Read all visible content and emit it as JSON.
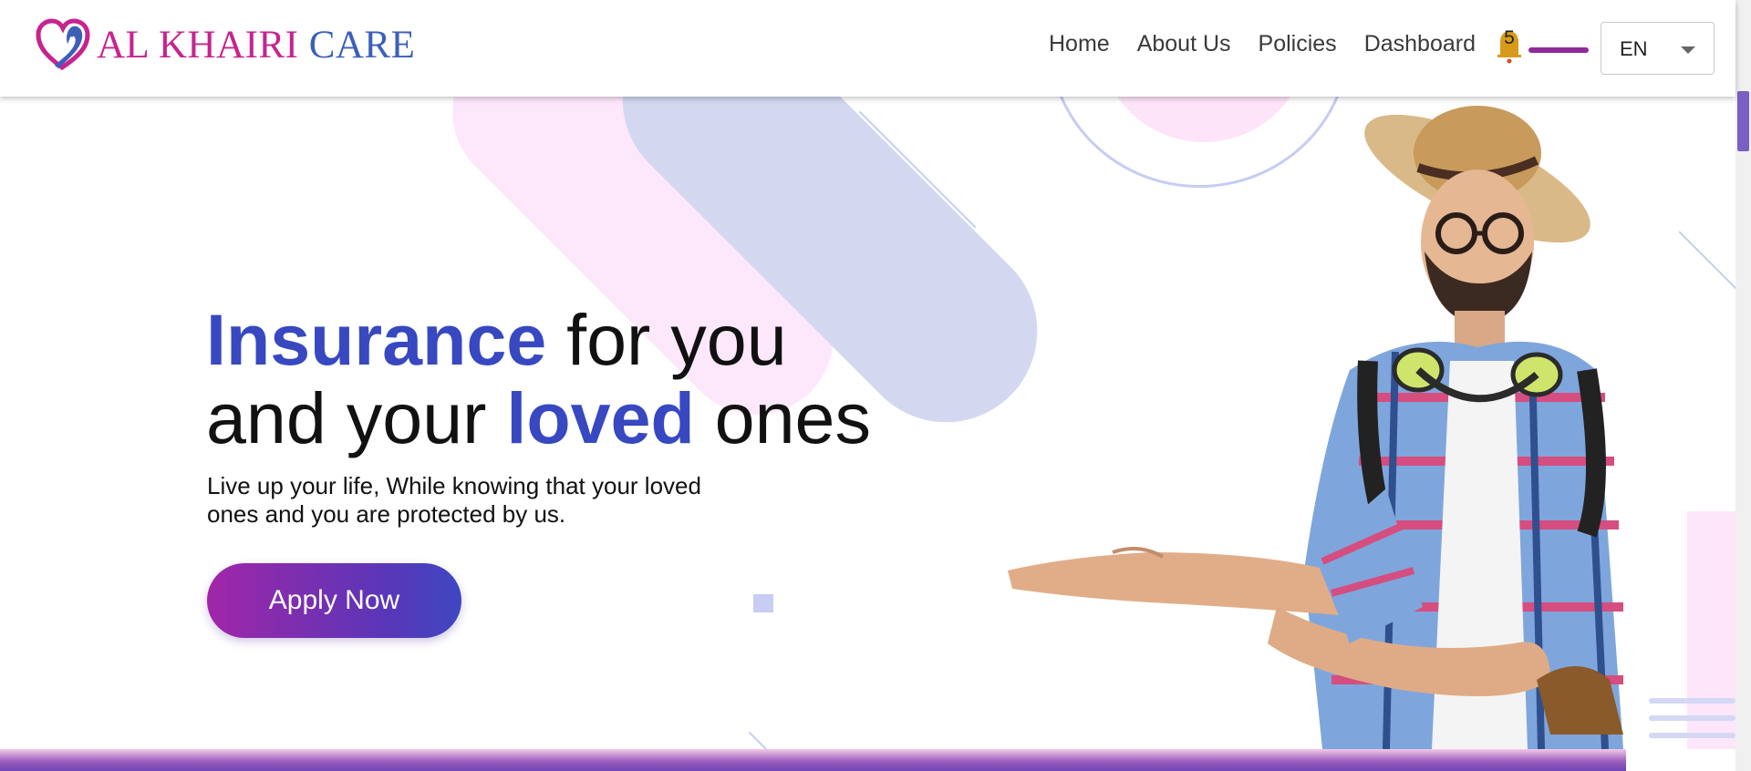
{
  "brand": {
    "name_part1": "AL KHAIRI",
    "name_part2": "CARE",
    "colors": {
      "pink": "#c6248f",
      "blue": "#3c5fb8"
    }
  },
  "nav": {
    "items": [
      {
        "label": "Home"
      },
      {
        "label": "About Us"
      },
      {
        "label": "Policies"
      },
      {
        "label": "Dashboard"
      }
    ]
  },
  "notifications": {
    "icon": "bell-icon",
    "count": "5",
    "badge_color": "#d79b1a"
  },
  "language": {
    "selected": "EN",
    "icon": "chevron-down-icon"
  },
  "hero": {
    "headline": {
      "word1": "Insurance",
      "text1": " for you",
      "text2": "and your ",
      "word2": "loved",
      "text3": " ones"
    },
    "subtext": "Live up your life, While knowing that your loved ones and you are protected by us.",
    "cta_label": "Apply Now",
    "accent_color": "#3748c0",
    "button_gradient": [
      "#a126a8",
      "#3f47c2"
    ]
  }
}
